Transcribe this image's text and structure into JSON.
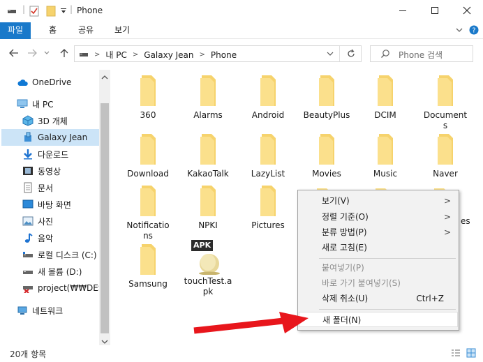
{
  "window": {
    "title": "Phone"
  },
  "ribbon": {
    "tabs": [
      "파일",
      "홈",
      "공유",
      "보기"
    ]
  },
  "address": {
    "breadcrumbs": [
      "내 PC",
      "Galaxy Jean",
      "Phone"
    ],
    "search_placeholder": "Phone 검색"
  },
  "sidebar": {
    "items": [
      {
        "label": "OneDrive",
        "icon": "cloud-icon"
      },
      {
        "label": "내 PC",
        "icon": "computer-icon"
      },
      {
        "label": "3D 개체",
        "icon": "3d-objects-icon"
      },
      {
        "label": "Galaxy Jean",
        "icon": "phone-device-icon",
        "selected": true
      },
      {
        "label": "다운로드",
        "icon": "download-arrow-icon"
      },
      {
        "label": "동영상",
        "icon": "video-icon"
      },
      {
        "label": "문서",
        "icon": "document-icon"
      },
      {
        "label": "바탕 화면",
        "icon": "desktop-icon"
      },
      {
        "label": "사진",
        "icon": "pictures-icon"
      },
      {
        "label": "음악",
        "icon": "music-note-icon"
      },
      {
        "label": "로컬 디스크 (C:)",
        "icon": "drive-icon"
      },
      {
        "label": "새 볼륨 (D:)",
        "icon": "drive-icon"
      },
      {
        "label": "project(₩₩DESK",
        "icon": "network-drive-icon"
      },
      {
        "label": "네트워크",
        "icon": "network-icon"
      }
    ]
  },
  "files": [
    {
      "name": "360",
      "type": "folder"
    },
    {
      "name": "Alarms",
      "type": "folder"
    },
    {
      "name": "Android",
      "type": "folder"
    },
    {
      "name": "BeautyPlus",
      "type": "folder"
    },
    {
      "name": "DCIM",
      "type": "folder"
    },
    {
      "name": "Document\ns",
      "type": "folder"
    },
    {
      "name": "Download",
      "type": "folder"
    },
    {
      "name": "KakaoTalk",
      "type": "folder"
    },
    {
      "name": "LazyList",
      "type": "folder"
    },
    {
      "name": "Movies",
      "type": "folder"
    },
    {
      "name": "Music",
      "type": "folder"
    },
    {
      "name": "Naver",
      "type": "folder"
    },
    {
      "name": "Notificatio\nns",
      "type": "folder"
    },
    {
      "name": "NPKI",
      "type": "folder"
    },
    {
      "name": "Pictures",
      "type": "folder"
    },
    {
      "name": "Samsung",
      "type": "folder"
    },
    {
      "name": "touchTest.a\npk",
      "type": "apk",
      "badge": "APK"
    }
  ],
  "context_menu": {
    "items": [
      {
        "label": "보기(V)",
        "submenu": true
      },
      {
        "label": "정렬 기준(O)",
        "submenu": true
      },
      {
        "label": "분류 방법(P)",
        "submenu": true
      },
      {
        "label": "새로 고침(E)"
      },
      {
        "label": "붙여넣기(P)",
        "disabled": true
      },
      {
        "label": "바로 가기 붙여넣기(S)",
        "disabled": true
      },
      {
        "label": "삭제 취소(U)",
        "shortcut": "Ctrl+Z"
      },
      {
        "label": "새 폴더(N)",
        "highlighted": true
      }
    ],
    "partial_label": "es"
  },
  "status": {
    "count": "20개 항목"
  },
  "colors": {
    "accent": "#1979ca",
    "folder": "#f6d36d",
    "arrow": "#e8161c",
    "selection": "#cce4f7"
  }
}
